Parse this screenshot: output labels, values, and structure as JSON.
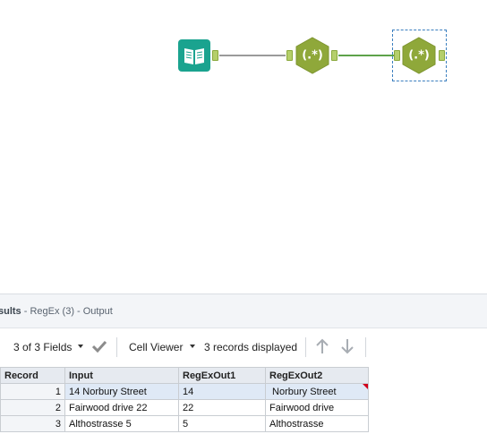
{
  "canvas": {
    "tools": [
      {
        "name": "input-data-tool",
        "icon": "book-icon"
      },
      {
        "name": "regex-tool-1",
        "label": "(.*)"
      },
      {
        "name": "regex-tool-2",
        "label": "(.*)",
        "selected": true
      }
    ],
    "colors": {
      "input_tool": "#1aa38f",
      "regex_tool": "#8fa83a",
      "anchor": "#b5cf6b",
      "connection_gray": "#9a9a9a",
      "connection_green": "#5da24a",
      "selection": "#3b7fbf"
    }
  },
  "results": {
    "title_prefix": "sults",
    "title_rest": " - RegEx (3) - Output",
    "toolbar": {
      "fields_label": "3 of 3 Fields",
      "checkmark_icon": "check-icon",
      "cell_viewer_label": "Cell Viewer",
      "records_label": "3 records displayed",
      "up_icon": "arrow-up-icon",
      "down_icon": "arrow-down-icon"
    },
    "grid": {
      "headers": [
        "Record",
        "Input",
        "RegExOut1",
        "RegExOut2"
      ],
      "rows": [
        [
          "1",
          "14 Norbury Street",
          "14",
          " Norbury Street"
        ],
        [
          "2",
          "Fairwood drive 22",
          "22",
          "Fairwood drive"
        ],
        [
          "3",
          "Althostrasse 5",
          "5",
          "Althostrasse"
        ]
      ]
    }
  }
}
